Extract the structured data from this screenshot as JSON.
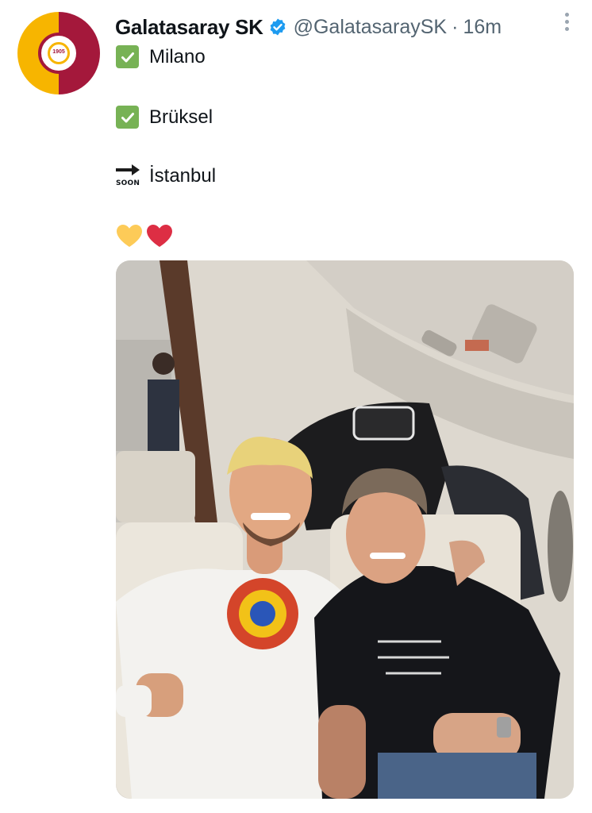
{
  "tweet": {
    "author_name": "Galatasaray SK",
    "handle": "@GalatasaraySK",
    "separator": "·",
    "time": "16m",
    "avatar_year": "1905",
    "lines": [
      {
        "icon": "check-mark-icon",
        "text": "Milano"
      },
      {
        "icon": "check-mark-icon",
        "text": "Brüksel"
      },
      {
        "icon": "soon-arrow-icon",
        "text": "İstanbul"
      }
    ],
    "soon_label": "SOON",
    "hearts": [
      "yellow-heart-icon",
      "red-heart-icon"
    ]
  },
  "colors": {
    "brand_yellow": "#f7b500",
    "brand_red": "#a4183b",
    "verified_blue": "#1d9bf0",
    "check_green": "#77b255",
    "heart_yellow": "#fdcb58",
    "heart_red": "#dd2e44"
  }
}
